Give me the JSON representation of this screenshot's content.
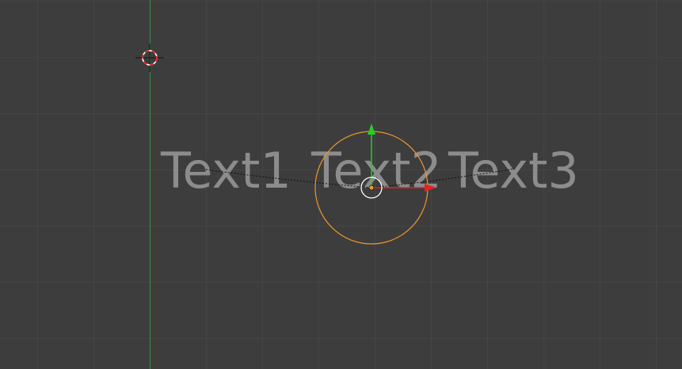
{
  "viewport": {
    "background": "#3d3d3d",
    "grid_color": "#464646"
  },
  "axes": {
    "x_axis_color": "#7a2a2a",
    "y_axis_color": "#3e8e3e"
  },
  "text_objects": [
    {
      "text": "Text1"
    },
    {
      "text": "Text2"
    },
    {
      "text": "Text3"
    }
  ],
  "selection": {
    "outline_color": "#f0962a"
  },
  "gizmo": {
    "x_color": "#e52222",
    "y_color": "#22d022"
  },
  "icons": {
    "cursor": "3d-cursor-icon",
    "transform": "transform-gizmo-icon"
  }
}
